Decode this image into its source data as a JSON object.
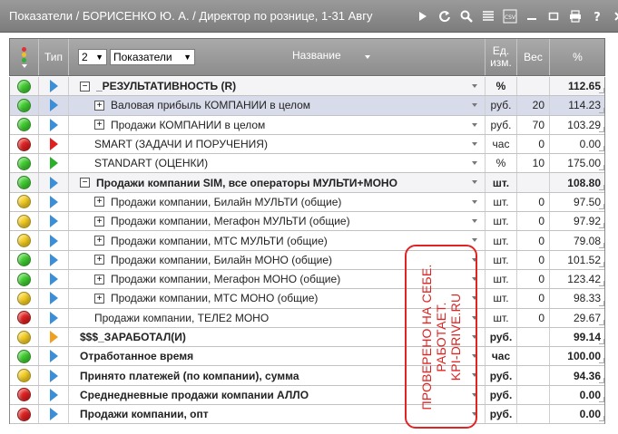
{
  "window": {
    "title": "Показатели / БОРИСЕНКО Ю. А. / Директор по рознице, 1-31 Авгу",
    "toolbar_icons": [
      "play-icon",
      "refresh-icon",
      "search-icon",
      "list-icon",
      "csv-icon",
      "minimize-icon",
      "maximize-icon",
      "print-icon",
      "help-icon",
      "close-icon"
    ]
  },
  "header": {
    "type_label": "Тип",
    "level_value": "2",
    "view_select": "Показатели",
    "name_label": "Название",
    "unit_label": "Ед. изм.",
    "weight_label": "Вес",
    "pct_label": "%"
  },
  "rows": [
    {
      "status": "green",
      "type": "blue",
      "expander": "minus",
      "indent": 0,
      "name": "_РЕЗУЛЬТАТИВНОСТЬ (R)",
      "unit": "%",
      "weight": "",
      "pct": "112.65",
      "bold": true,
      "style": "alt"
    },
    {
      "status": "green",
      "type": "blue",
      "expander": "plus",
      "indent": 1,
      "name": "Валовая прибыль КОМПАНИИ в целом",
      "unit": "руб.",
      "weight": "20",
      "pct": "114.23",
      "bold": false,
      "style": "sel"
    },
    {
      "status": "green",
      "type": "blue",
      "expander": "plus",
      "indent": 1,
      "name": "Продажи КОМПАНИИ в целом",
      "unit": "руб.",
      "weight": "70",
      "pct": "103.29",
      "bold": false,
      "style": ""
    },
    {
      "status": "red",
      "type": "red",
      "expander": "",
      "indent": 1,
      "name": "SMART (ЗАДАЧИ И ПОРУЧЕНИЯ)",
      "unit": "час",
      "weight": "0",
      "pct": "0.00",
      "bold": false,
      "style": ""
    },
    {
      "status": "green",
      "type": "green",
      "expander": "",
      "indent": 1,
      "name": "STANDART (ОЦЕНКИ)",
      "unit": "%",
      "weight": "10",
      "pct": "175.00",
      "bold": false,
      "style": ""
    },
    {
      "status": "green",
      "type": "blue",
      "expander": "minus",
      "indent": 0,
      "name": "Продажи компании SIM, все операторы МУЛЬТИ+МОНО",
      "unit": "шт.",
      "weight": "",
      "pct": "108.80",
      "bold": true,
      "style": "alt"
    },
    {
      "status": "yellow",
      "type": "blue",
      "expander": "plus",
      "indent": 1,
      "name": "Продажи компании, Билайн МУЛЬТИ (общие)",
      "unit": "шт.",
      "weight": "0",
      "pct": "97.50",
      "bold": false,
      "style": ""
    },
    {
      "status": "yellow",
      "type": "blue",
      "expander": "plus",
      "indent": 1,
      "name": "Продажи компании, Мегафон МУЛЬТИ (общие)",
      "unit": "шт.",
      "weight": "0",
      "pct": "97.92",
      "bold": false,
      "style": ""
    },
    {
      "status": "yellow",
      "type": "blue",
      "expander": "plus",
      "indent": 1,
      "name": "Продажи компании, МТС МУЛЬТИ (общие)",
      "unit": "шт.",
      "weight": "0",
      "pct": "79.08",
      "bold": false,
      "style": ""
    },
    {
      "status": "green",
      "type": "blue",
      "expander": "plus",
      "indent": 1,
      "name": "Продажи компании, Билайн МОНО (общие)",
      "unit": "шт.",
      "weight": "0",
      "pct": "101.52",
      "bold": false,
      "style": ""
    },
    {
      "status": "green",
      "type": "blue",
      "expander": "plus",
      "indent": 1,
      "name": "Продажи компании, Мегафон МОНО (общие)",
      "unit": "шт.",
      "weight": "0",
      "pct": "123.42",
      "bold": false,
      "style": ""
    },
    {
      "status": "yellow",
      "type": "blue",
      "expander": "plus",
      "indent": 1,
      "name": "Продажи компании, МТС МОНО (общие)",
      "unit": "шт.",
      "weight": "0",
      "pct": "98.33",
      "bold": false,
      "style": ""
    },
    {
      "status": "red",
      "type": "blue",
      "expander": "",
      "indent": 1,
      "name": "Продажи компании, ТЕЛЕ2 МОНО",
      "unit": "шт.",
      "weight": "0",
      "pct": "29.67",
      "bold": false,
      "style": ""
    },
    {
      "status": "yellow",
      "type": "orange",
      "expander": "",
      "indent": 0,
      "name": "$$$_ЗАРАБОТАЛ(И)",
      "unit": "руб.",
      "weight": "",
      "pct": "99.14",
      "bold": true,
      "style": ""
    },
    {
      "status": "green",
      "type": "blue",
      "expander": "",
      "indent": 0,
      "name": "Отработанное время",
      "unit": "час",
      "weight": "",
      "pct": "100.00",
      "bold": true,
      "style": ""
    },
    {
      "status": "yellow",
      "type": "blue",
      "expander": "",
      "indent": 0,
      "name": "Принято платежей (по компании), сумма",
      "unit": "руб.",
      "weight": "",
      "pct": "94.36",
      "bold": true,
      "style": ""
    },
    {
      "status": "red",
      "type": "blue",
      "expander": "",
      "indent": 0,
      "name": "Среднедневные продажи компании АЛЛО",
      "unit": "руб.",
      "weight": "",
      "pct": "0.00",
      "bold": true,
      "style": ""
    },
    {
      "status": "red",
      "type": "blue",
      "expander": "",
      "indent": 0,
      "name": "Продажи компании, опт",
      "unit": "руб.",
      "weight": "",
      "pct": "0.00",
      "bold": true,
      "style": ""
    }
  ],
  "stamp": {
    "lines": [
      "ПРОВЕРЕНО НА СЕБЕ.",
      "РАБОТАЕТ.",
      "KPI-DRIVE.RU"
    ]
  }
}
